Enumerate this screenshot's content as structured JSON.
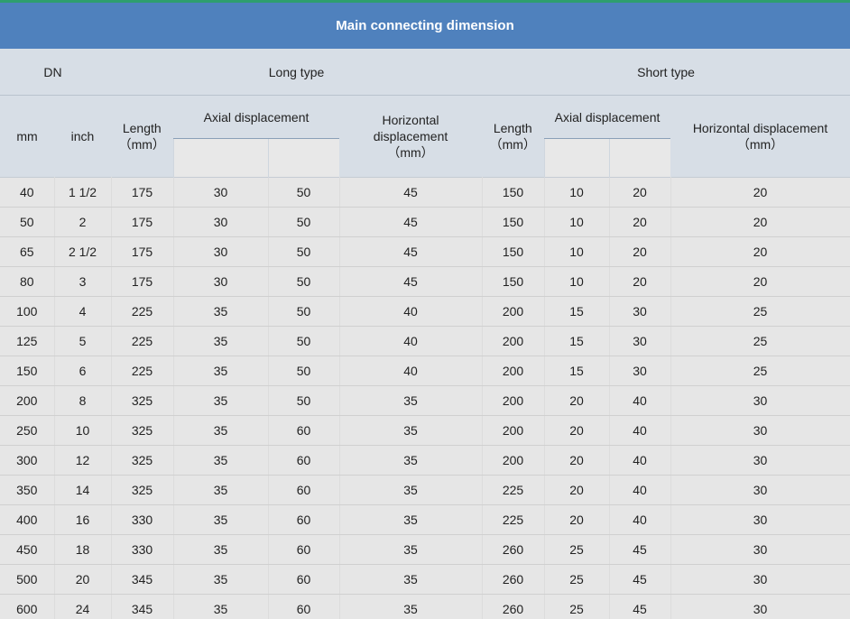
{
  "title": "Main connecting dimension",
  "header": {
    "dn": "DN",
    "long_type": "Long type",
    "short_type": "Short type",
    "mm": "mm",
    "inch": "inch",
    "length": "Length",
    "length_unit": "（mm）",
    "axial_displacement": "Axial displacement",
    "horizontal_displacement_long_l1": "Horizontal",
    "horizontal_displacement_long_l2": "displacement",
    "horizontal_displacement_long_unit": "（mm）",
    "horizontal_displacement_short": "Horizontal displacement",
    "horizontal_displacement_short_unit": "（mm）"
  },
  "rows": [
    [
      "40",
      "1 1/2",
      "175",
      "30",
      "50",
      "45",
      "150",
      "10",
      "20",
      "20"
    ],
    [
      "50",
      "2",
      "175",
      "30",
      "50",
      "45",
      "150",
      "10",
      "20",
      "20"
    ],
    [
      "65",
      "2 1/2",
      "175",
      "30",
      "50",
      "45",
      "150",
      "10",
      "20",
      "20"
    ],
    [
      "80",
      "3",
      "175",
      "30",
      "50",
      "45",
      "150",
      "10",
      "20",
      "20"
    ],
    [
      "100",
      "4",
      "225",
      "35",
      "50",
      "40",
      "200",
      "15",
      "30",
      "25"
    ],
    [
      "125",
      "5",
      "225",
      "35",
      "50",
      "40",
      "200",
      "15",
      "30",
      "25"
    ],
    [
      "150",
      "6",
      "225",
      "35",
      "50",
      "40",
      "200",
      "15",
      "30",
      "25"
    ],
    [
      "200",
      "8",
      "325",
      "35",
      "50",
      "35",
      "200",
      "20",
      "40",
      "30"
    ],
    [
      "250",
      "10",
      "325",
      "35",
      "60",
      "35",
      "200",
      "20",
      "40",
      "30"
    ],
    [
      "300",
      "12",
      "325",
      "35",
      "60",
      "35",
      "200",
      "20",
      "40",
      "30"
    ],
    [
      "350",
      "14",
      "325",
      "35",
      "60",
      "35",
      "225",
      "20",
      "40",
      "30"
    ],
    [
      "400",
      "16",
      "330",
      "35",
      "60",
      "35",
      "225",
      "20",
      "40",
      "30"
    ],
    [
      "450",
      "18",
      "330",
      "35",
      "60",
      "35",
      "260",
      "25",
      "45",
      "30"
    ],
    [
      "500",
      "20",
      "345",
      "35",
      "60",
      "35",
      "260",
      "25",
      "45",
      "30"
    ],
    [
      "600",
      "24",
      "345",
      "35",
      "60",
      "35",
      "260",
      "25",
      "45",
      "30"
    ]
  ]
}
